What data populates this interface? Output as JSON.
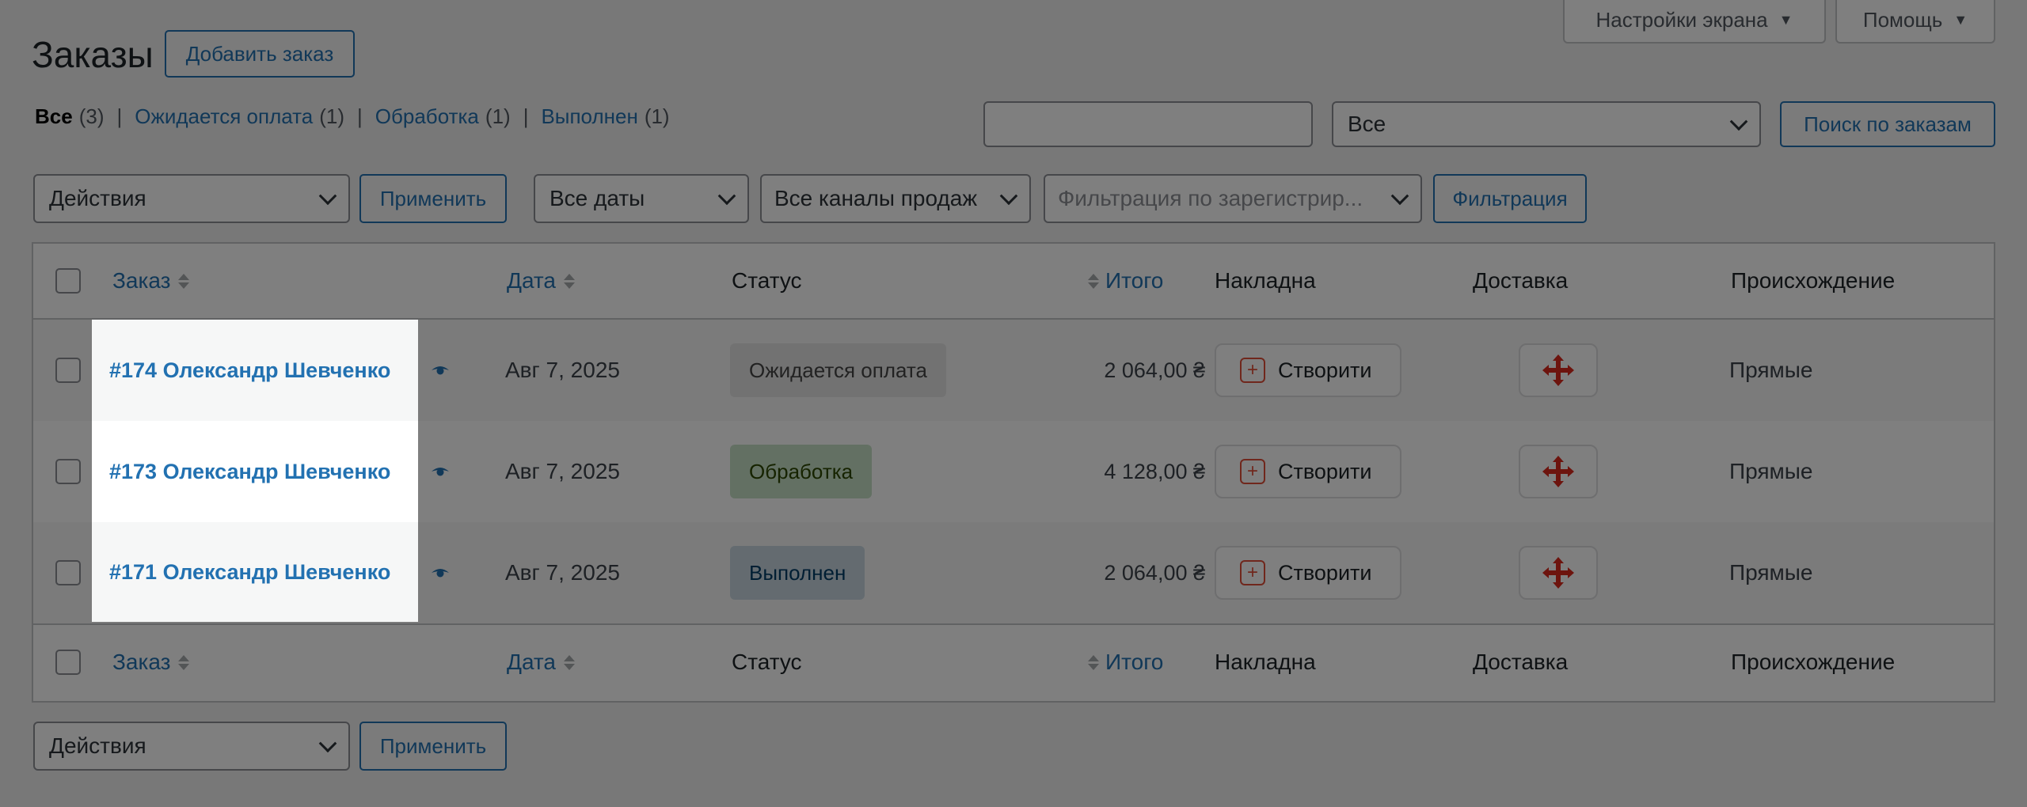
{
  "screen_meta": {
    "screen_options_label": "Настройки экрана",
    "help_label": "Помощь"
  },
  "header": {
    "title": "Заказы",
    "add_order_label": "Добавить заказ"
  },
  "status_filter": {
    "all_label": "Все",
    "all_count": "(3)",
    "pending_label": "Ожидается оплата",
    "pending_count": "(1)",
    "processing_label": "Обработка",
    "processing_count": "(1)",
    "completed_label": "Выполнен",
    "completed_count": "(1)"
  },
  "search": {
    "value": "",
    "scope_value": "Все",
    "submit_label": "Поиск по заказам"
  },
  "tablenav_top": {
    "bulk_actions_value": "Действия",
    "apply_label": "Применить",
    "date_filter_value": "Все даты",
    "channel_filter_value": "Все каналы продаж",
    "customer_filter_placeholder": "Фильтрация по зарегистрир...",
    "filter_label": "Фильтрация"
  },
  "columns": {
    "order": "Заказ",
    "date": "Дата",
    "status": "Статус",
    "total": "Итого",
    "invoice": "Накладна",
    "shipping": "Доставка",
    "origin": "Происхождение"
  },
  "orders": [
    {
      "title": "#174 Олександр Шевченко",
      "date": "Авг 7, 2025",
      "status": "Ожидается оплата",
      "status_key": "pending",
      "total": "2 064,00 ₴",
      "invoice_label": "Створити",
      "origin": "Прямые"
    },
    {
      "title": "#173 Олександр Шевченко",
      "date": "Авг 7, 2025",
      "status": "Обработка",
      "status_key": "processing",
      "total": "4 128,00 ₴",
      "invoice_label": "Створити",
      "origin": "Прямые"
    },
    {
      "title": "#171 Олександр Шевченко",
      "date": "Авг 7, 2025",
      "status": "Выполнен",
      "status_key": "completed",
      "total": "2 064,00 ₴",
      "invoice_label": "Створити",
      "origin": "Прямые"
    }
  ],
  "tablenav_bottom": {
    "bulk_actions_value": "Действия",
    "apply_label": "Применить"
  },
  "colors": {
    "link": "#2271b1",
    "pending_bg": "#e5e5e5",
    "processing_bg": "#c6e1c6",
    "completed_bg": "#c8d7e1",
    "nova_poshta_red": "#da291c"
  }
}
